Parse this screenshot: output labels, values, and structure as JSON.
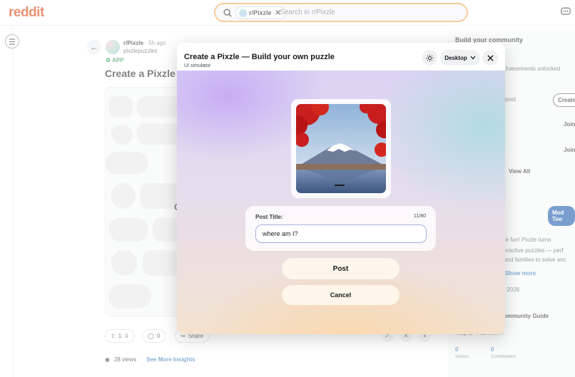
{
  "app": {
    "logo": "reddit"
  },
  "search": {
    "chip_label": "r/Pixzle",
    "placeholder": "Search in r/Pixzle"
  },
  "post": {
    "subreddit": "r/Pixzle",
    "time": "· 5h ago",
    "author": "pixzlepuzzles",
    "app_badge": "APP",
    "title": "Create a Pixzle",
    "preview_letter": "C",
    "upvotes": "1",
    "comments": "0",
    "share_label": "Share",
    "views": "28 views",
    "insights_link": "See More Insights"
  },
  "sidebar": {
    "title": "Build your community",
    "achievements": "chievements unlocked",
    "post_label": "post",
    "create_label": "Create",
    "join1": "Join",
    "join2": "Join",
    "view_all": "View All",
    "mod_tools": "Mod Too",
    "about_line1": "re fun! Pixzle turns",
    "about_line2": "eractive puzzles — perf",
    "about_line3": "and families to solve anc",
    "show_more": "Show more",
    "year": ", 2026",
    "guide": "ommunity Guide",
    "insights": "Insights · Past week ›",
    "visitors_value": "0",
    "visitors_label": "Visitors",
    "contrib_value": "0",
    "contrib_label": "Contributions"
  },
  "modal": {
    "title": "Create a Pixzle — Build your own puzzle",
    "subtitle": "UI simulator",
    "device_label": "Desktop",
    "field_label": "Post Title:",
    "char_count": "11/80",
    "title_value": "where am I?",
    "post_label": "Post",
    "cancel_label": "Cancel"
  },
  "icons": {
    "search": "search-icon",
    "close": "close-icon",
    "theme": "sun-icon",
    "chevron": "chevron-down-icon",
    "back": "arrow-left-icon",
    "menu": "hamburger-icon",
    "chat": "chat-icon"
  },
  "colors": {
    "brand": "#d93a00",
    "search_border": "#f2a14a",
    "link": "#2b6cb0",
    "mod_tools": "#0e4fa8"
  }
}
